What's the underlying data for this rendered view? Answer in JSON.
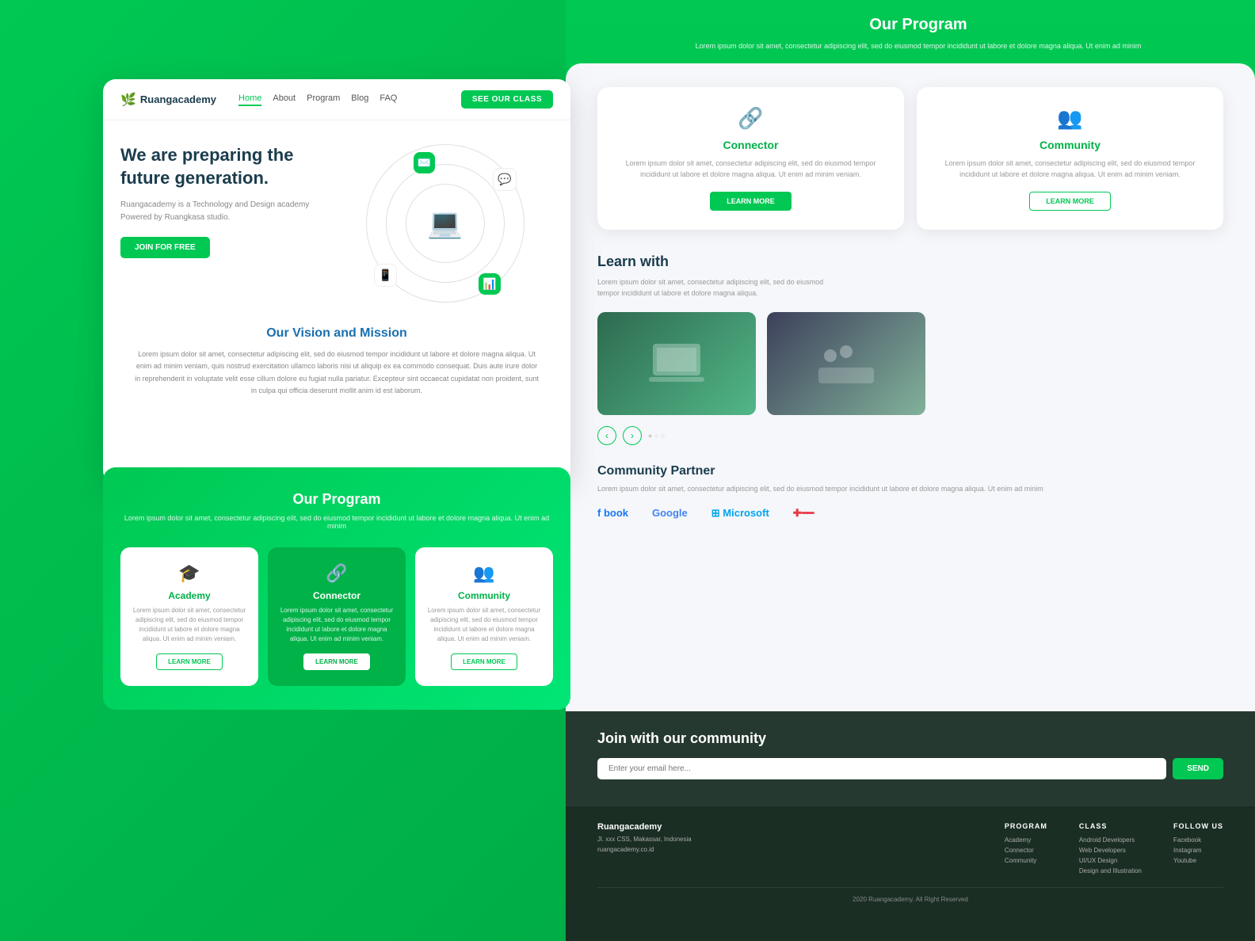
{
  "nav": {
    "logo": "Ruangacademy",
    "links": [
      "Home",
      "About",
      "Program",
      "Blog",
      "FAQ"
    ],
    "active_link": "Home",
    "cta": "SEE OUR CLASS"
  },
  "hero": {
    "title": "We are preparing the future generation.",
    "subtitle": "Ruangacademy is a Technology and Design academy\nPowered by Ruangkasa studio.",
    "cta": "JOIN FOR FREE"
  },
  "vision": {
    "title": "Our Vision and Mission",
    "text": "Lorem ipsum dolor sit amet, consectetur adipiscing elit, sed do eiusmod tempor incididunt ut labore et dolore magna aliqua. Ut enim ad minim veniam, quis nostrud exercitation ullamco laboris nisi ut aliquip ex ea commodo consequat. Duis aute irure dolor in reprehenderit in voluptate velit esse cillum dolore eu fugiat nulla pariatur. Excepteur sint occaecat cupidatat non proident, sunt in culpa qui officia deserunt mollit anim id est laborum."
  },
  "our_program": {
    "title": "Our Program",
    "subtitle": "Lorem ipsum dolor sit amet, consectetur adipiscing elit, sed do eiusmod tempor incididunt ut labore et dolore magna aliqua. Ut enim ad minim",
    "cards": [
      {
        "name": "Academy",
        "desc": "Lorem ipsum dolor sit amet, consectetur adipiscing elit, sed do eiusmod tempor incididunt ut labore et dolore magna aliqua. Ut enim ad minim veniam.",
        "btn": "LEARN MORE",
        "active": false,
        "icon": "🎓"
      },
      {
        "name": "Connector",
        "desc": "Lorem ipsum dolor sit amet, consectetur adipiscing elit, sed do eiusmod tempor incididunt ut labore et dolore magna aliqua. Ut enim ad minim veniam.",
        "btn": "LEARN MORE",
        "active": true,
        "icon": "🔗"
      },
      {
        "name": "Community",
        "desc": "Lorem ipsum dolor sit amet, consectetur adipiscing elit, sed do eiusmod tempor incididunt ut labore et dolore magna aliqua. Ut enim ad minim veniam.",
        "btn": "LEARN MORE",
        "active": false,
        "icon": "👥"
      }
    ]
  },
  "right_program": {
    "title": "Our Program",
    "subtitle": "Lorem ipsum dolor sit amet, consectetur adipiscing elit, sed do eiusmod tempor incididunt ut labore et dolore magna aliqua. Ut enim ad minim",
    "cards": [
      {
        "name": "Connector",
        "desc": "Lorem ipsum dolor sit amet, consectetur adipiscing elit, sed do eiusmod tempor incididunt ut labore et dolore magna aliqua. Ut enim ad minim veniam.",
        "btn": "LEARN MORE",
        "active": false,
        "icon": "🔗"
      },
      {
        "name": "Community",
        "desc": "Lorem ipsum dolor sit amet, consectetur adipiscing elit, sed do eiusmod tempor incididunt ut labore et dolore magna aliqua. Ut enim ad minim veniam.",
        "btn": "LEARN MORE",
        "active": false,
        "icon": "👥"
      }
    ]
  },
  "learn": {
    "title": "Learn with",
    "text": "Lorem ipsum dolor sit amet, consectetur adipiscing elit, sed do eiusmod tempor incididunt ut labore et dolore magna aliqua."
  },
  "community": {
    "title": "Community Partner",
    "text": "Lorem ipsum dolor sit amet, consectetur adipiscing elit, sed do eiusmod tempor incididunt ut labore et dolore magna aliqua. Ut enim ad minim",
    "partners": [
      "book",
      "Google",
      "Microsoft",
      "✚"
    ]
  },
  "join": {
    "title": "Join with our community",
    "placeholder": "Enter your email here...",
    "btn": "SEND"
  },
  "footer": {
    "brand": "Ruangacademy",
    "address": "Jl. xxx CSS, Makassar, Indonesia",
    "website": "ruangacademy.co.id",
    "program_title": "PROGRAM",
    "program_links": [
      "Academy",
      "Connector",
      "Community"
    ],
    "class_title": "CLASS",
    "class_links": [
      "Android Developers",
      "Web Developers",
      "UI/UX Design",
      "Design and Illustration"
    ],
    "follow_title": "FOLLOW US",
    "follow_links": [
      "Facebook",
      "Instagram",
      "Youtube"
    ],
    "copyright": "2020 Ruangacademy. All Right Reserved"
  }
}
